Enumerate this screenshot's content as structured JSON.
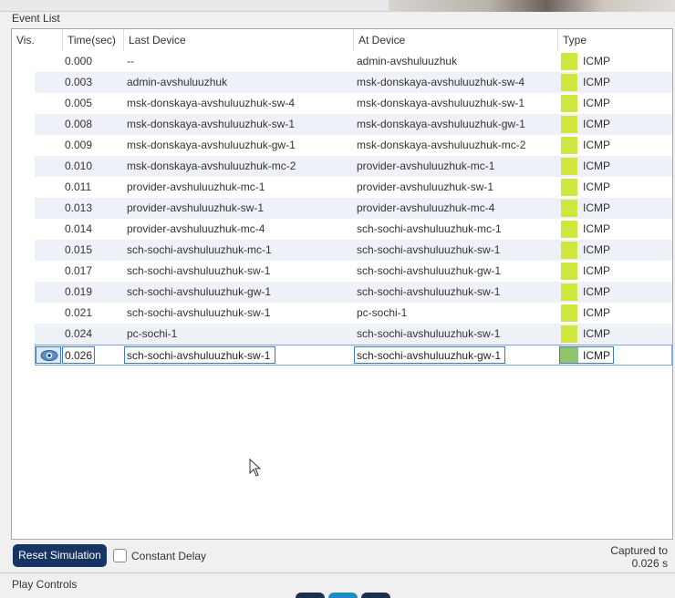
{
  "section": {
    "event_list_title": "Event List",
    "play_controls_title": "Play Controls"
  },
  "table": {
    "headers": {
      "vis": "Vis.",
      "time": "Time(sec)",
      "last_device": "Last Device",
      "at_device": "At Device",
      "type": "Type"
    },
    "rows": [
      {
        "time": "0.000",
        "last": "--",
        "at": "admin-avshuluuzhuk",
        "type": "ICMP"
      },
      {
        "time": "0.003",
        "last": "admin-avshuluuzhuk",
        "at": "msk-donskaya-avshuluuzhuk-sw-4",
        "type": "ICMP"
      },
      {
        "time": "0.005",
        "last": "msk-donskaya-avshuluuzhuk-sw-4",
        "at": "msk-donskaya-avshuluuzhuk-sw-1",
        "type": "ICMP"
      },
      {
        "time": "0.008",
        "last": "msk-donskaya-avshuluuzhuk-sw-1",
        "at": "msk-donskaya-avshuluuzhuk-gw-1",
        "type": "ICMP"
      },
      {
        "time": "0.009",
        "last": "msk-donskaya-avshuluuzhuk-gw-1",
        "at": "msk-donskaya-avshuluuzhuk-mc-2",
        "type": "ICMP"
      },
      {
        "time": "0.010",
        "last": "msk-donskaya-avshuluuzhuk-mc-2",
        "at": "provider-avshuluuzhuk-mc-1",
        "type": "ICMP"
      },
      {
        "time": "0.011",
        "last": "provider-avshuluuzhuk-mc-1",
        "at": "provider-avshuluuzhuk-sw-1",
        "type": "ICMP"
      },
      {
        "time": "0.013",
        "last": "provider-avshuluuzhuk-sw-1",
        "at": "provider-avshuluuzhuk-mc-4",
        "type": "ICMP"
      },
      {
        "time": "0.014",
        "last": "provider-avshuluuzhuk-mc-4",
        "at": "sch-sochi-avshuluuzhuk-mc-1",
        "type": "ICMP"
      },
      {
        "time": "0.015",
        "last": "sch-sochi-avshuluuzhuk-mc-1",
        "at": "sch-sochi-avshuluuzhuk-sw-1",
        "type": "ICMP"
      },
      {
        "time": "0.017",
        "last": "sch-sochi-avshuluuzhuk-sw-1",
        "at": "sch-sochi-avshuluuzhuk-gw-1",
        "type": "ICMP"
      },
      {
        "time": "0.019",
        "last": "sch-sochi-avshuluuzhuk-gw-1",
        "at": "sch-sochi-avshuluuzhuk-sw-1",
        "type": "ICMP"
      },
      {
        "time": "0.021",
        "last": "sch-sochi-avshuluuzhuk-sw-1",
        "at": "pc-sochi-1",
        "type": "ICMP"
      },
      {
        "time": "0.024",
        "last": "pc-sochi-1",
        "at": "sch-sochi-avshuluuzhuk-sw-1",
        "type": "ICMP"
      },
      {
        "time": "0.026",
        "last": "sch-sochi-avshuluuzhuk-sw-1",
        "at": "sch-sochi-avshuluuzhuk-gw-1",
        "type": "ICMP"
      }
    ],
    "selected_row_index": 14
  },
  "controls": {
    "reset_label": "Reset Simulation",
    "constant_delay_label": "Constant Delay",
    "constant_delay_checked": false,
    "captured_to_label": "Captured to",
    "captured_to_value": "0.026 s"
  },
  "icons": {
    "visibility": "eye-icon",
    "pointer": "cursor-icon"
  },
  "colors": {
    "icmp_swatch": "#cfe63e",
    "selected_swatch": "#8fc46a",
    "reset_button": "#173564",
    "selection_border": "#3b7bc8"
  }
}
